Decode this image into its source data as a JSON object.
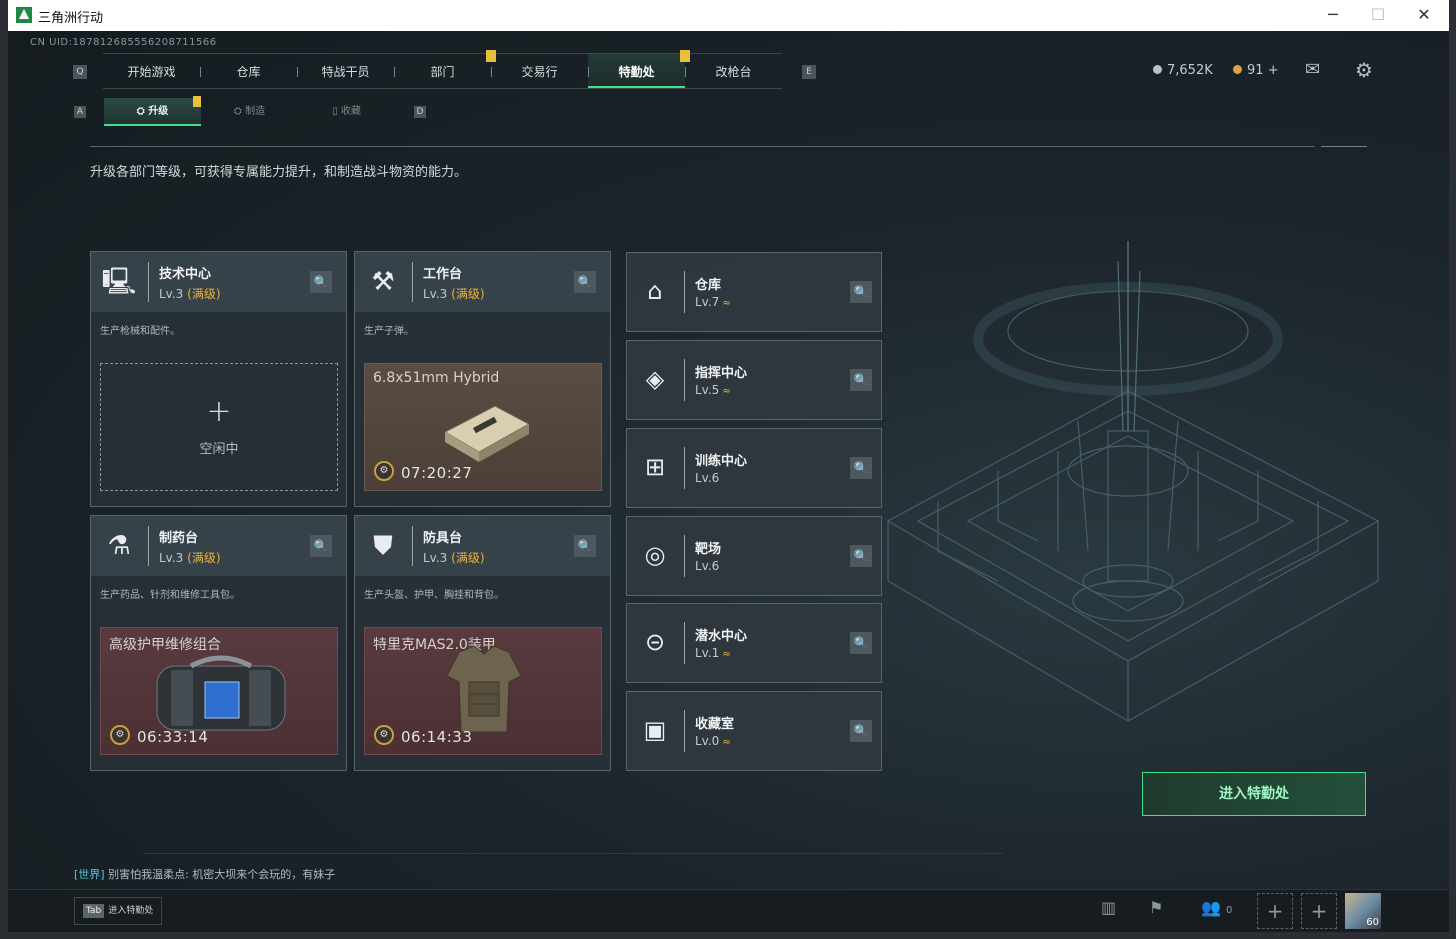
{
  "window": {
    "title": "三角洲行动",
    "controls": [
      "─",
      "☐",
      "✕"
    ]
  },
  "uid": "CN UID:18781268555620871156​6",
  "nav": {
    "left_key": "Q",
    "right_key": "E",
    "tabs": [
      {
        "label": "开始游戏",
        "active": false,
        "badge": false
      },
      {
        "label": "仓库",
        "active": false,
        "badge": false
      },
      {
        "label": "特战干员",
        "active": false,
        "badge": false
      },
      {
        "label": "部门",
        "active": false,
        "badge": true
      },
      {
        "label": "交易行",
        "active": false,
        "badge": false
      },
      {
        "label": "特勤处",
        "active": true,
        "badge": true
      },
      {
        "label": "改枪台",
        "active": false,
        "badge": false
      }
    ]
  },
  "currency": {
    "silver": "7,652K",
    "gold": "91",
    "gold_add": "+"
  },
  "subnav": {
    "left_key": "A",
    "right_key": "D",
    "tabs": [
      {
        "label": "升级",
        "icon": "upgrade-icon",
        "active": true
      },
      {
        "label": "制造",
        "icon": "craft-icon",
        "active": false
      },
      {
        "label": "收藏",
        "icon": "collection-icon",
        "active": false
      }
    ]
  },
  "description": "升级各部门等级，可获得专属能力提升，和制造战斗物资的能力。",
  "workshops": [
    {
      "name": "技术中心",
      "level": "Lv.3",
      "max": "(满级)",
      "sub": "生产枪械和配件。",
      "icon": "computer-icon",
      "slot": {
        "type": "empty",
        "plus": "+",
        "status": "空闲中"
      }
    },
    {
      "name": "工作台",
      "level": "Lv.3",
      "max": "(满级)",
      "sub": "生产子弹。",
      "icon": "tools-icon",
      "slot": {
        "type": "brown",
        "item": "6.8x51mm Hybrid",
        "timer": "07:20:27"
      }
    },
    {
      "name": "制药台",
      "level": "Lv.3",
      "max": "(满级)",
      "sub": "生产药品、针剂和维修工具包。",
      "icon": "microscope-icon",
      "slot": {
        "type": "red",
        "item": "高级护甲维修组合",
        "timer": "06:33:14"
      }
    },
    {
      "name": "防具台",
      "level": "Lv.3",
      "max": "(满级)",
      "sub": "生产头盔、护甲、胸挂和背包。",
      "icon": "armor-icon",
      "slot": {
        "type": "red",
        "item": "特里克MAS2.0装甲",
        "timer": "06:14:33"
      }
    }
  ],
  "facilities": [
    {
      "name": "仓库",
      "level": "Lv.7",
      "upgradable": true,
      "icon": "warehouse-icon",
      "glyph": "⌂"
    },
    {
      "name": "指挥中心",
      "level": "Lv.5",
      "upgradable": true,
      "icon": "command-icon",
      "glyph": "◈"
    },
    {
      "name": "训练中心",
      "level": "Lv.6",
      "upgradable": false,
      "icon": "dumbbell-icon",
      "glyph": "⊞"
    },
    {
      "name": "靶场",
      "level": "Lv.6",
      "upgradable": false,
      "icon": "target-icon",
      "glyph": "◎"
    },
    {
      "name": "潜水中心",
      "level": "Lv.1",
      "upgradable": true,
      "icon": "goggles-icon",
      "glyph": "⊝"
    },
    {
      "name": "收藏室",
      "level": "Lv.0",
      "upgradable": true,
      "icon": "collection-room-icon",
      "glyph": "▣"
    }
  ],
  "upgrade_glyph": "≈",
  "enter_button": "进入特勤处",
  "chat": {
    "channel": "[世界]",
    "message": "别害怕我温柔点: 机密大坝来个会玩的，有妹子"
  },
  "bottom": {
    "tab_key": "Tab",
    "tab_label": "进入特勤处",
    "friends_count": "0",
    "avatar_level": "60"
  },
  "colors": {
    "accent_green": "#3fe08a",
    "max_level_gold": "#e8b13a",
    "badge_yellow": "#e8c040"
  }
}
